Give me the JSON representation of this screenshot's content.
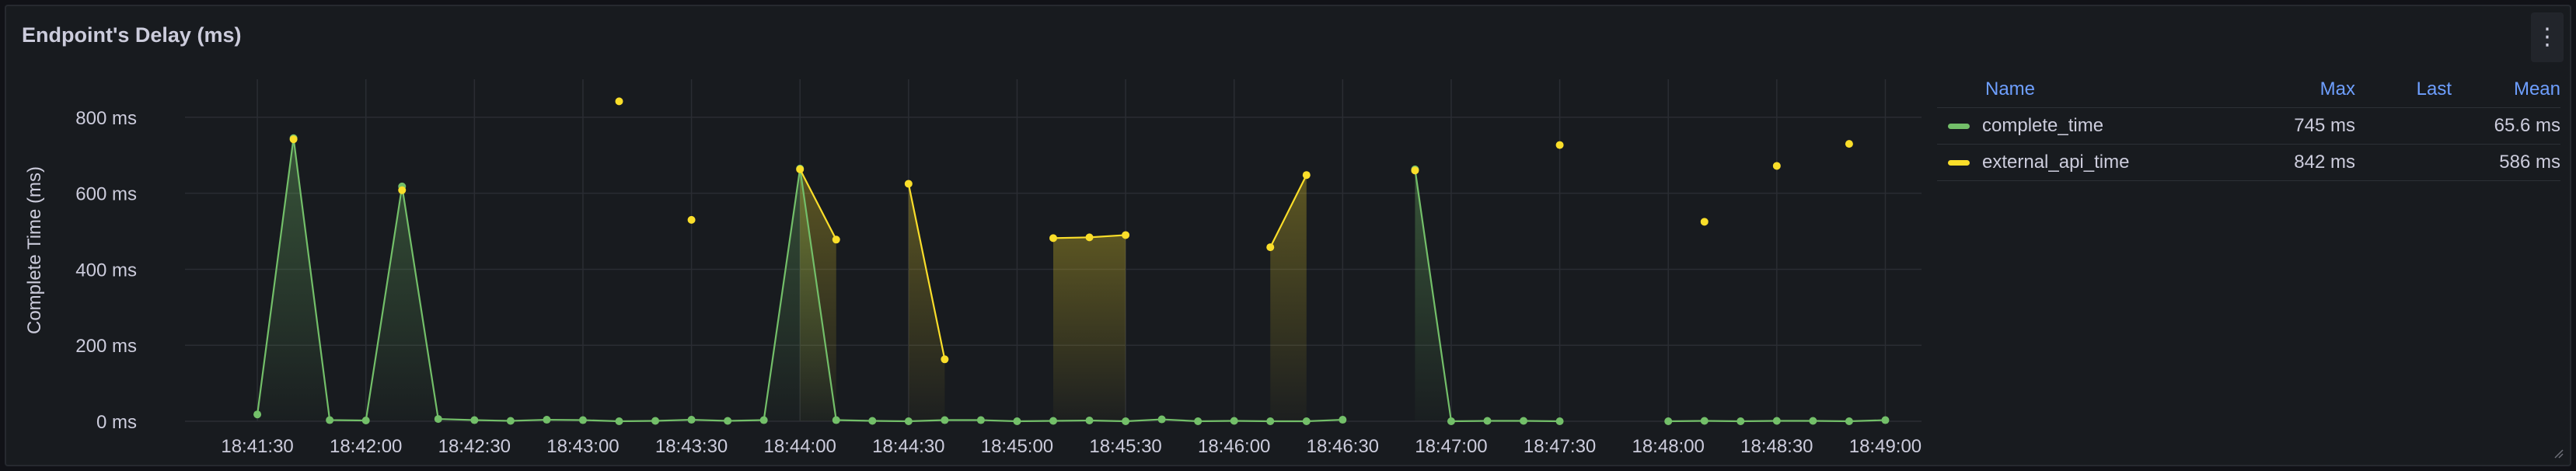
{
  "panel": {
    "title": "Endpoint's Delay (ms)",
    "menu_icon": "kebab-menu-icon"
  },
  "legend": {
    "headers": {
      "name": "Name",
      "max": "Max",
      "last": "Last",
      "mean": "Mean"
    },
    "rows": [
      {
        "name": "complete_time",
        "max": "745 ms",
        "last": "",
        "mean": "65.6 ms",
        "color": "#73bf69"
      },
      {
        "name": "external_api_time",
        "max": "842 ms",
        "last": "",
        "mean": "586 ms",
        "color": "#fade2a"
      }
    ]
  },
  "chart_data": {
    "type": "line",
    "ylabel": "Complete Time (ms)",
    "ylim": [
      0,
      900
    ],
    "yticks": [
      0,
      200,
      400,
      600,
      800
    ],
    "ytick_labels": [
      "0 ms",
      "200 ms",
      "400 ms",
      "600 ms",
      "800 ms"
    ],
    "xlim": [
      "18:41:10",
      "18:49:10"
    ],
    "xticks": [
      "18:41:30",
      "18:42:00",
      "18:42:30",
      "18:43:00",
      "18:43:30",
      "18:44:00",
      "18:44:30",
      "18:45:00",
      "18:45:30",
      "18:46:00",
      "18:46:30",
      "18:47:00",
      "18:47:30",
      "18:48:00",
      "18:48:30",
      "18:49:00"
    ],
    "grid": true,
    "legend": "right",
    "series": [
      {
        "name": "complete_time",
        "color": "#73bf69",
        "points": [
          [
            "18:41:30",
            18
          ],
          [
            "18:41:40",
            745
          ],
          [
            "18:41:50",
            3
          ],
          [
            "18:42:00",
            2
          ],
          [
            "18:42:10",
            618
          ],
          [
            "18:42:20",
            6
          ],
          [
            "18:42:30",
            3
          ],
          [
            "18:42:40",
            1
          ],
          [
            "18:42:50",
            4
          ],
          [
            "18:43:00",
            3
          ],
          [
            "18:43:10",
            0
          ],
          [
            "18:43:20",
            1
          ],
          [
            "18:43:30",
            4
          ],
          [
            "18:43:40",
            1
          ],
          [
            "18:43:50",
            3
          ],
          [
            "18:44:00",
            665
          ],
          [
            "18:44:10",
            3
          ],
          [
            "18:44:20",
            1
          ],
          [
            "18:44:30",
            0
          ],
          [
            "18:44:40",
            3
          ],
          [
            "18:44:50",
            3
          ],
          [
            "18:45:00",
            0
          ],
          [
            "18:45:10",
            1
          ],
          [
            "18:45:20",
            2
          ],
          [
            "18:45:30",
            0
          ],
          [
            "18:45:40",
            5
          ],
          [
            "18:45:50",
            0
          ],
          [
            "18:46:00",
            1
          ],
          [
            "18:46:10",
            0
          ],
          [
            "18:46:20",
            0
          ],
          [
            "18:46:30",
            4
          ],
          null,
          [
            "18:46:50",
            663
          ],
          [
            "18:47:00",
            0
          ],
          [
            "18:47:10",
            1
          ],
          [
            "18:47:20",
            1
          ],
          [
            "18:47:30",
            0
          ],
          null,
          null,
          [
            "18:48:00",
            0
          ],
          [
            "18:48:10",
            1
          ],
          [
            "18:48:20",
            0
          ],
          [
            "18:48:30",
            1
          ],
          [
            "18:48:40",
            1
          ],
          [
            "18:48:50",
            0
          ],
          [
            "18:49:00",
            3
          ]
        ]
      },
      {
        "name": "external_api_time",
        "color": "#fade2a",
        "points": [
          [
            "18:41:40",
            742
          ],
          null,
          [
            "18:42:10",
            608
          ],
          null,
          [
            "18:43:10",
            842
          ],
          null,
          [
            "18:43:30",
            530
          ],
          null,
          [
            "18:44:00",
            663
          ],
          [
            "18:44:10",
            478
          ],
          null,
          [
            "18:44:30",
            625
          ],
          [
            "18:44:40",
            163
          ],
          null,
          [
            "18:45:10",
            482
          ],
          [
            "18:45:20",
            484
          ],
          [
            "18:45:30",
            490
          ],
          null,
          [
            "18:46:10",
            458
          ],
          [
            "18:46:20",
            648
          ],
          null,
          [
            "18:46:50",
            660
          ],
          null,
          [
            "18:47:30",
            727
          ],
          null,
          [
            "18:48:10",
            525
          ],
          null,
          [
            "18:48:30",
            672
          ],
          null,
          [
            "18:48:50",
            730
          ]
        ]
      }
    ]
  }
}
